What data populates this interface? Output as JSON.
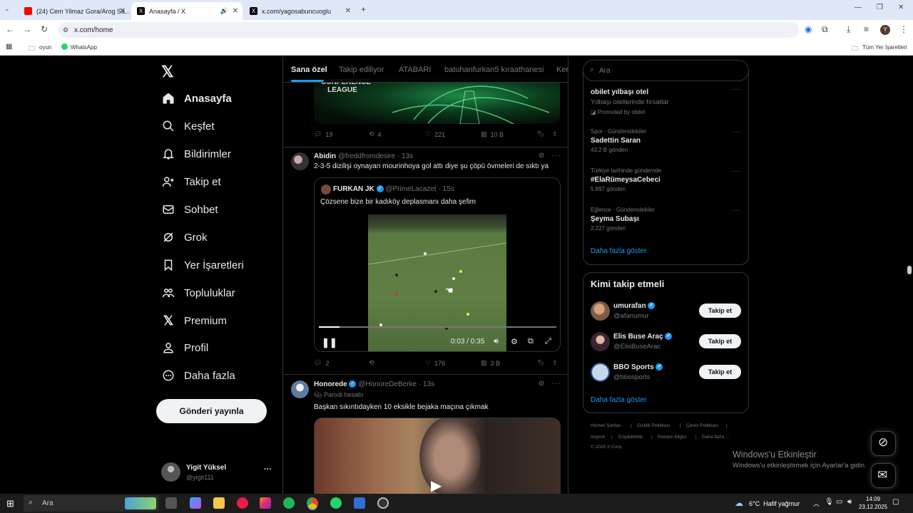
{
  "browser": {
    "tabs": [
      {
        "title": "(24) Cem Yilmaz Gora/Arog Sa..."
      },
      {
        "title": "Anasayfa / X"
      },
      {
        "title": "x.com/yagosabuncuoglu"
      }
    ],
    "url": "x.com/home",
    "bookmarks": [
      "oyun",
      "WhatsApp"
    ],
    "all_bookmarks": "Tüm Yer İşaretleri",
    "profile_initial": "Y"
  },
  "nav": {
    "home": "Anasayfa",
    "explore": "Keşfet",
    "notifications": "Bildirimler",
    "follow": "Takip et",
    "messages": "Sohbet",
    "grok": "Grok",
    "bookmarks": "Yer İşaretleri",
    "communities": "Topluluklar",
    "premium": "Premium",
    "profile": "Profil",
    "more": "Daha fazla",
    "post_button": "Gönderi yayınla"
  },
  "account": {
    "name": "Yigit Yüksel",
    "handle": "@yigit111"
  },
  "feed_tabs": [
    "Sana özel",
    "Takip ediliyor",
    "ATABARI",
    "batuhanfurkan5 kıraathanesi",
    "Ker"
  ],
  "post0": {
    "banner_text": "CONFERENCE LEAGUE",
    "replies": "19",
    "reposts": "4",
    "likes": "221",
    "views": "10 B"
  },
  "post1": {
    "name": "Abidin",
    "handle": "@freddfromdesire",
    "time": "· 13s",
    "text": "2-3-5 dizilişi oynayan mourinhoya gol attı diye şu çöpü övmeleri de sıktı ya",
    "quote": {
      "name": "FURKAN JK",
      "handle": "@PrimeLacazet",
      "time": "· 15s",
      "text": "Çözsene bize bir kadıköy deplasmanı daha şefim"
    },
    "video_time": "0:03 / 0:35",
    "video_progress": 0.086,
    "replies": "2",
    "reposts": "",
    "likes": "176",
    "views": "3 B"
  },
  "post2": {
    "name": "Honorede",
    "handle": "@HonoreDeBerke",
    "time": "· 13s",
    "label": "Parodi hesabı",
    "text": "Başkan sıkıntıdayken 10 eksikle bejaka maçına çıkmak"
  },
  "search": {
    "placeholder": "Ara"
  },
  "trends": [
    {
      "meta": "",
      "title": "obilet yılbaşı otel",
      "sub": "Yılbaşı otellerinde fırsatlar",
      "count": "Promoted by obilet"
    },
    {
      "meta": "Spor · Gündemdekiler",
      "title": "Sadettin Saran",
      "count": "43,2 B gönderi"
    },
    {
      "meta": "Türkiye tarihinde gündemde",
      "title": "#ElaRümeysaCebeci",
      "count": "5.897 gönderi"
    },
    {
      "meta": "Eğlence · Gündemdekiler",
      "title": "Şeyma Subaşı",
      "count": "2.227 gönderi"
    }
  ],
  "show_more": "Daha fazla göster",
  "who_to_follow": {
    "title": "Kimi takip etmeli",
    "users": [
      {
        "name": "umurafan",
        "handle": "@afanumur"
      },
      {
        "name": "Elis Buse Araç",
        "handle": "@ElisBuseArac"
      },
      {
        "name": "BBO Sports",
        "handle": "@bbosports"
      }
    ],
    "follow_label": "Takip et",
    "show_more": "Daha fazla göster"
  },
  "footer": {
    "links": [
      "Hizmet Şartları",
      "Gizlilik Politikası",
      "Çerez Politikası",
      "Imprint",
      "Erişilebilirlik",
      "Reklam bilgisi",
      "Daha fazla ..."
    ],
    "copyright": "© 2025 X Corp."
  },
  "watermark": {
    "title": "Windows'u Etkinleştir",
    "sub": "Windows'u etkinleştirmek için Ayarlar'a gidin."
  },
  "taskbar": {
    "search": "Ara",
    "weather": "6°C  Hafif yağmur",
    "time": "14:09",
    "date": "23.12.2025"
  }
}
